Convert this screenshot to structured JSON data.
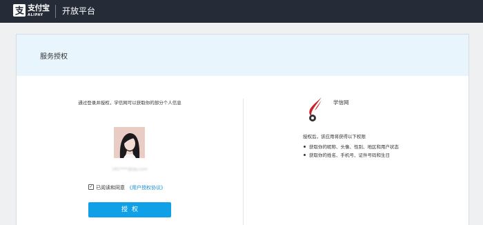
{
  "header": {
    "logo_cn": "支付宝",
    "logo_en": "ALIPAY",
    "title": "开放平台"
  },
  "card": {
    "title": "服务授权"
  },
  "left": {
    "consent_text": "通过登录并授权，学信网可以获取你的部分个人信息",
    "account": "181****@qq.com",
    "agree_text": "已阅读和同意",
    "agree_link": "《用户授权协议》",
    "agree_checked": true,
    "authorize_button": "授权"
  },
  "right": {
    "app_name": "学信网",
    "intro": "授权后，该应用将获得以下权限",
    "permissions": [
      "获取你的昵称、头像、性别、地区和用户状态",
      "获取你的姓名、手机号、证件号码和生日"
    ]
  },
  "colors": {
    "topbar": "#262b38",
    "header_band": "#e9f5fc",
    "button": "#0fa0e8",
    "link": "#1a8cd8",
    "app_icon_red": "#c8202c"
  }
}
